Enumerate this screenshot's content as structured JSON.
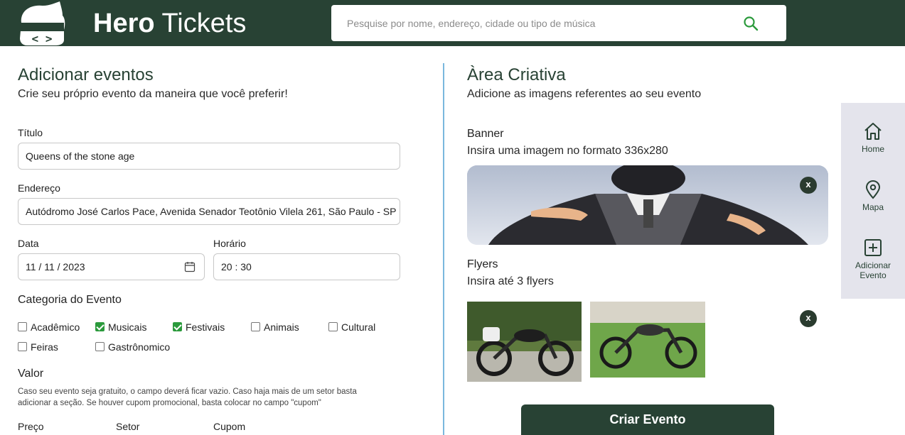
{
  "header": {
    "brand_bold": "Hero",
    "brand_light": " Tickets",
    "search_placeholder": "Pesquise por nome, endereço, cidade ou tipo de música",
    "logo_glyph": "< >"
  },
  "form": {
    "title": "Adicionar eventos",
    "subtitle": "Crie seu próprio evento da maneira que você preferir!",
    "titulo_label": "Título",
    "titulo_value": "Queens of the stone age",
    "endereco_label": "Endereço",
    "endereco_value": "Autódromo José Carlos Pace, Avenida Senador Teotônio Vilela 261, São Paulo - SP",
    "data_label": "Data",
    "data_value": "11 / 11 / 2023",
    "horario_label": "Horário",
    "horario_value": "20 : 30",
    "categoria_label": "Categoria do Evento",
    "categories": [
      {
        "label": "Acadêmico",
        "checked": false
      },
      {
        "label": "Musicais",
        "checked": true
      },
      {
        "label": "Festivais",
        "checked": true
      },
      {
        "label": "Animais",
        "checked": false
      },
      {
        "label": "Cultural",
        "checked": false
      },
      {
        "label": "Feiras",
        "checked": false
      },
      {
        "label": "Gastrônomico",
        "checked": false
      }
    ],
    "valor_label": "Valor",
    "valor_help_1": "Caso seu evento seja gratuito, o campo deverá ficar vazio. Caso haja mais de um setor basta",
    "valor_help_2": "adicionar a seção. Se houver cupom promocional, basta colocar no campo \"cupom\"",
    "col_preco": "Preço",
    "col_setor": "Setor",
    "col_cupom": "Cupom"
  },
  "creative": {
    "title": "Àrea Criativa",
    "subtitle": "Adicione as imagens referentes ao seu evento",
    "banner_label": "Banner",
    "banner_hint": "Insira uma imagem no formato 336x280",
    "flyers_label": "Flyers",
    "flyers_hint": "Insira até 3 flyers",
    "remove_glyph": "x",
    "submit_label": "Criar Evento"
  },
  "sidenav": {
    "home": "Home",
    "mapa": "Mapa",
    "add_1": "Adicionar",
    "add_2": "Evento"
  },
  "colors": {
    "brand": "#284234",
    "check": "#2b9a3c",
    "divider": "#7ab8de",
    "sidenav_bg": "#e4e4ec"
  }
}
